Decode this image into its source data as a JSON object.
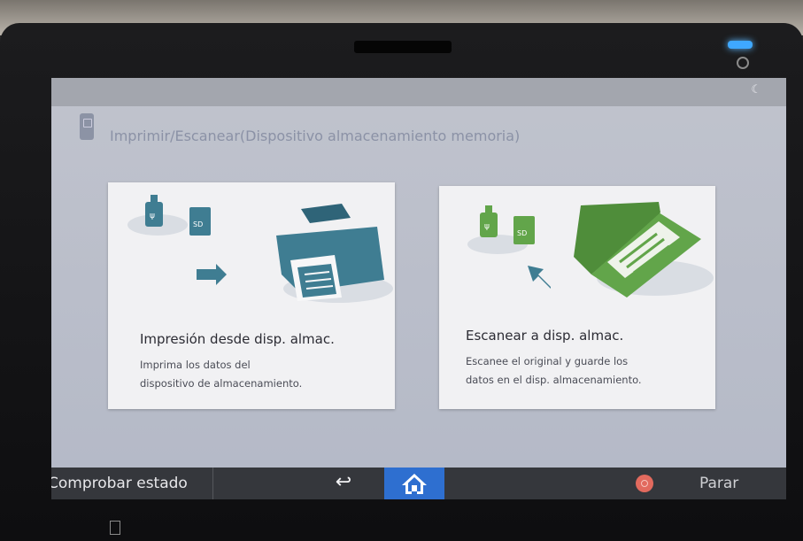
{
  "header": {
    "title": "Imprimir/Escanear(Dispositivo almacenamiento memoria)",
    "app_icon": "usb-memory-icon"
  },
  "status_bar": {
    "icon": "moon-icon",
    "icon_glyph": "☾"
  },
  "cards": [
    {
      "title": "Impresión desde disp. almac.",
      "description_lines": [
        "Imprima los datos del",
        "dispositivo de almacenamiento."
      ],
      "icon": "printer-icon",
      "accent": "#3f7d92"
    },
    {
      "title": "Escanear a disp. almac.",
      "description_lines": [
        "Escanee el original y guarde los",
        "datos en el disp. almacenamiento."
      ],
      "icon": "scanner-icon",
      "accent": "#62a54a"
    }
  ],
  "bottom_bar": {
    "check_status_label": "Comprobar estado",
    "back_glyph": "↩",
    "home_icon": "home-icon",
    "stop_icon": "stop-icon",
    "stop_label": "Parar",
    "home_color": "#2e6fd0"
  },
  "device": {
    "led_color": "#3fa8ff",
    "power_icon": "power-icon"
  }
}
